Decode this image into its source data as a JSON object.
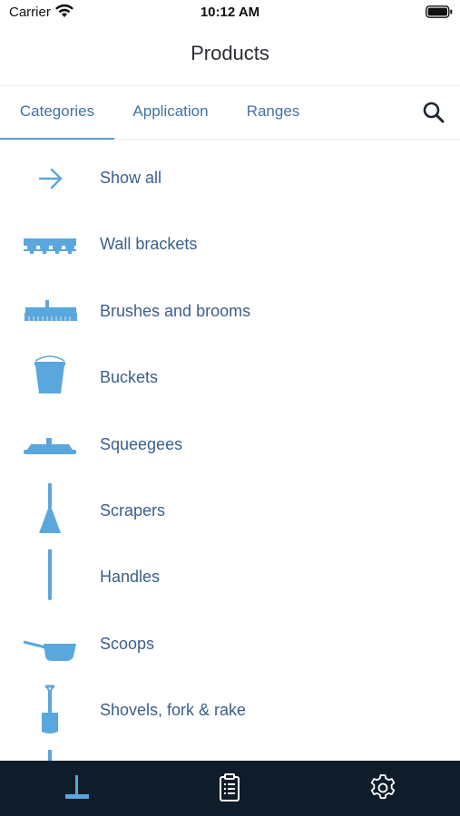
{
  "status_bar": {
    "carrier": "Carrier",
    "time": "10:12 AM"
  },
  "header": {
    "title": "Products"
  },
  "tabs": [
    {
      "label": "Categories",
      "selected": true
    },
    {
      "label": "Application",
      "selected": false
    },
    {
      "label": "Ranges",
      "selected": false
    }
  ],
  "categories": [
    {
      "label": "Show all",
      "icon": "arrow-right-icon"
    },
    {
      "label": "Wall brackets",
      "icon": "wall-bracket-icon"
    },
    {
      "label": "Brushes and brooms",
      "icon": "broom-icon"
    },
    {
      "label": "Buckets",
      "icon": "bucket-icon"
    },
    {
      "label": "Squeegees",
      "icon": "squeegee-icon"
    },
    {
      "label": "Scrapers",
      "icon": "scraper-icon"
    },
    {
      "label": "Handles",
      "icon": "handle-icon"
    },
    {
      "label": "Scoops",
      "icon": "scoop-icon"
    },
    {
      "label": "Shovels, fork & rake",
      "icon": "shovel-icon"
    }
  ],
  "bottom_tabs": [
    {
      "icon": "products-icon",
      "selected": true
    },
    {
      "icon": "clipboard-list-icon",
      "selected": false
    },
    {
      "icon": "gear-icon",
      "selected": false
    }
  ],
  "colors": {
    "accent": "#4fa3dd",
    "icon_blue": "#5aa7dd",
    "tab_text": "#3f73a6",
    "item_text": "#3a5f8b",
    "tab_bar_bg": "#0f1c2a"
  }
}
